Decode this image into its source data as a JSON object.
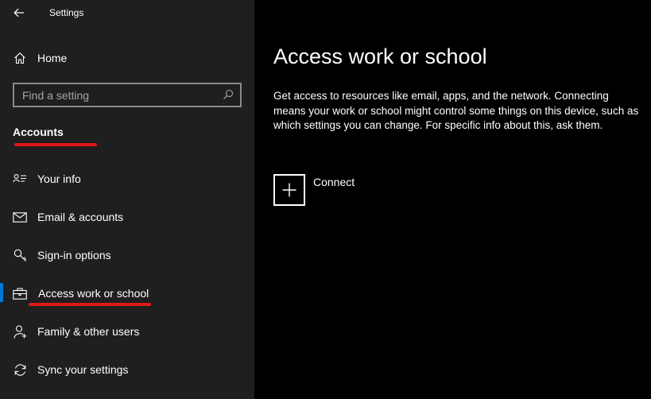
{
  "window": {
    "title": "Settings"
  },
  "sidebar": {
    "home_label": "Home",
    "search": {
      "placeholder": "Find a setting"
    },
    "section_heading": "Accounts",
    "items": [
      {
        "label": "Your info",
        "icon": "contact-info-icon"
      },
      {
        "label": "Email & accounts",
        "icon": "mail-icon"
      },
      {
        "label": "Sign-in options",
        "icon": "key-icon"
      },
      {
        "label": "Access work or school",
        "icon": "briefcase-icon",
        "selected": true
      },
      {
        "label": "Family & other users",
        "icon": "add-person-icon"
      },
      {
        "label": "Sync your settings",
        "icon": "sync-icon"
      }
    ]
  },
  "main": {
    "title": "Access work or school",
    "description": "Get access to resources like email, apps, and the network. Connecting means your work or school might control some things on this device, such as which settings you can change. For specific info about this, ask them.",
    "connect_label": "Connect"
  },
  "colors": {
    "sidebar_bg": "#1f1f1f",
    "main_bg": "#000000",
    "accent": "#0078d7",
    "annotation_red": "#e01818"
  }
}
